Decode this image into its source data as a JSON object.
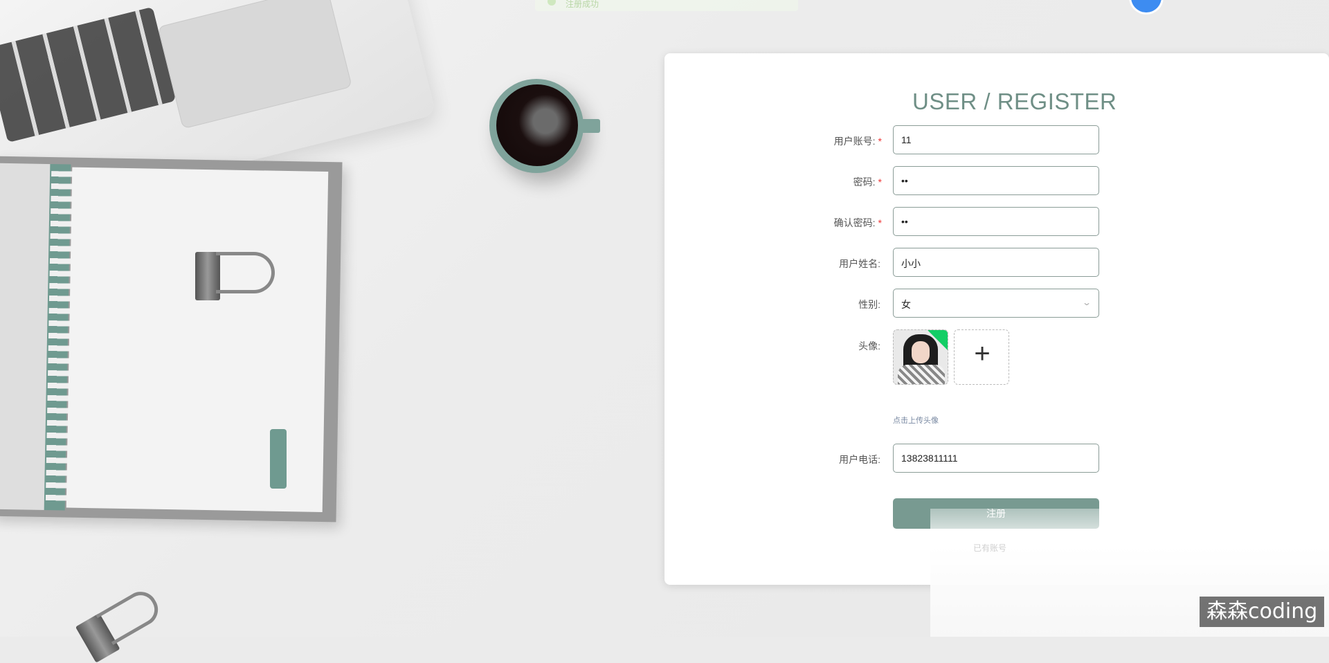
{
  "toast": {
    "text": "注册成功"
  },
  "form": {
    "title": "USER / REGISTER",
    "fields": {
      "account": {
        "label": "用户账号:",
        "value": "11",
        "required": true
      },
      "password": {
        "label": "密码:",
        "value": "••",
        "required": true
      },
      "confirm_password": {
        "label": "确认密码:",
        "value": "••",
        "required": true
      },
      "name": {
        "label": "用户姓名:",
        "value": "小小",
        "required": false
      },
      "gender": {
        "label": "性别:",
        "value": "女",
        "options_selected": "女"
      },
      "avatar": {
        "label": "头像:",
        "hint": "点击上传头像"
      },
      "phone": {
        "label": "用户电话:",
        "value": "13823811111",
        "required": false
      }
    },
    "submit_label": "注册",
    "secondary_link": "已有账号"
  },
  "required_mark": "*",
  "watermark": "森森coding",
  "colors": {
    "accent": "#789a91",
    "title": "#6f8f86",
    "required": "#ee3333"
  }
}
